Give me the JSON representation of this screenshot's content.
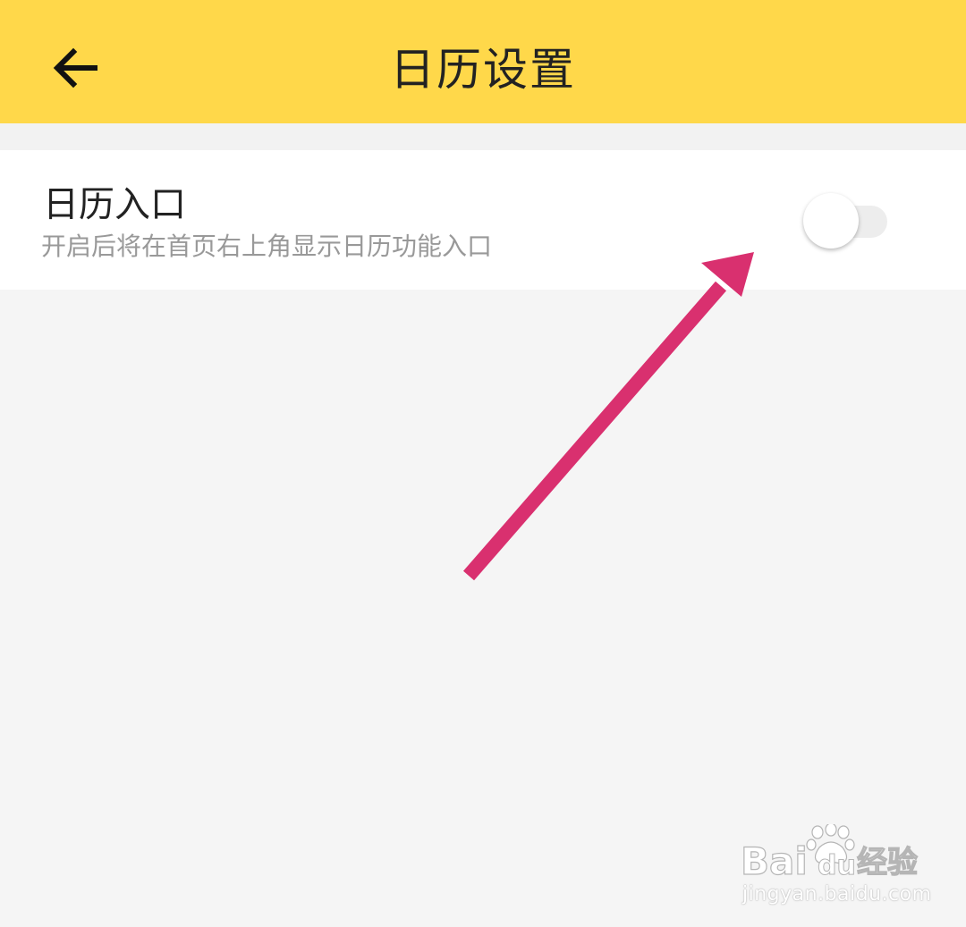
{
  "header": {
    "title": "日历设置",
    "back_icon": "arrow-left-icon",
    "background_color": "#ffd84a"
  },
  "setting": {
    "title": "日历入口",
    "description": "开启后将在首页右上角显示日历功能入口",
    "toggle_state": "off"
  },
  "annotation": {
    "arrow_color": "#d9306f"
  },
  "watermark": {
    "logo_text": "Bai du 经验",
    "url": "jingyan.baidu.com"
  }
}
